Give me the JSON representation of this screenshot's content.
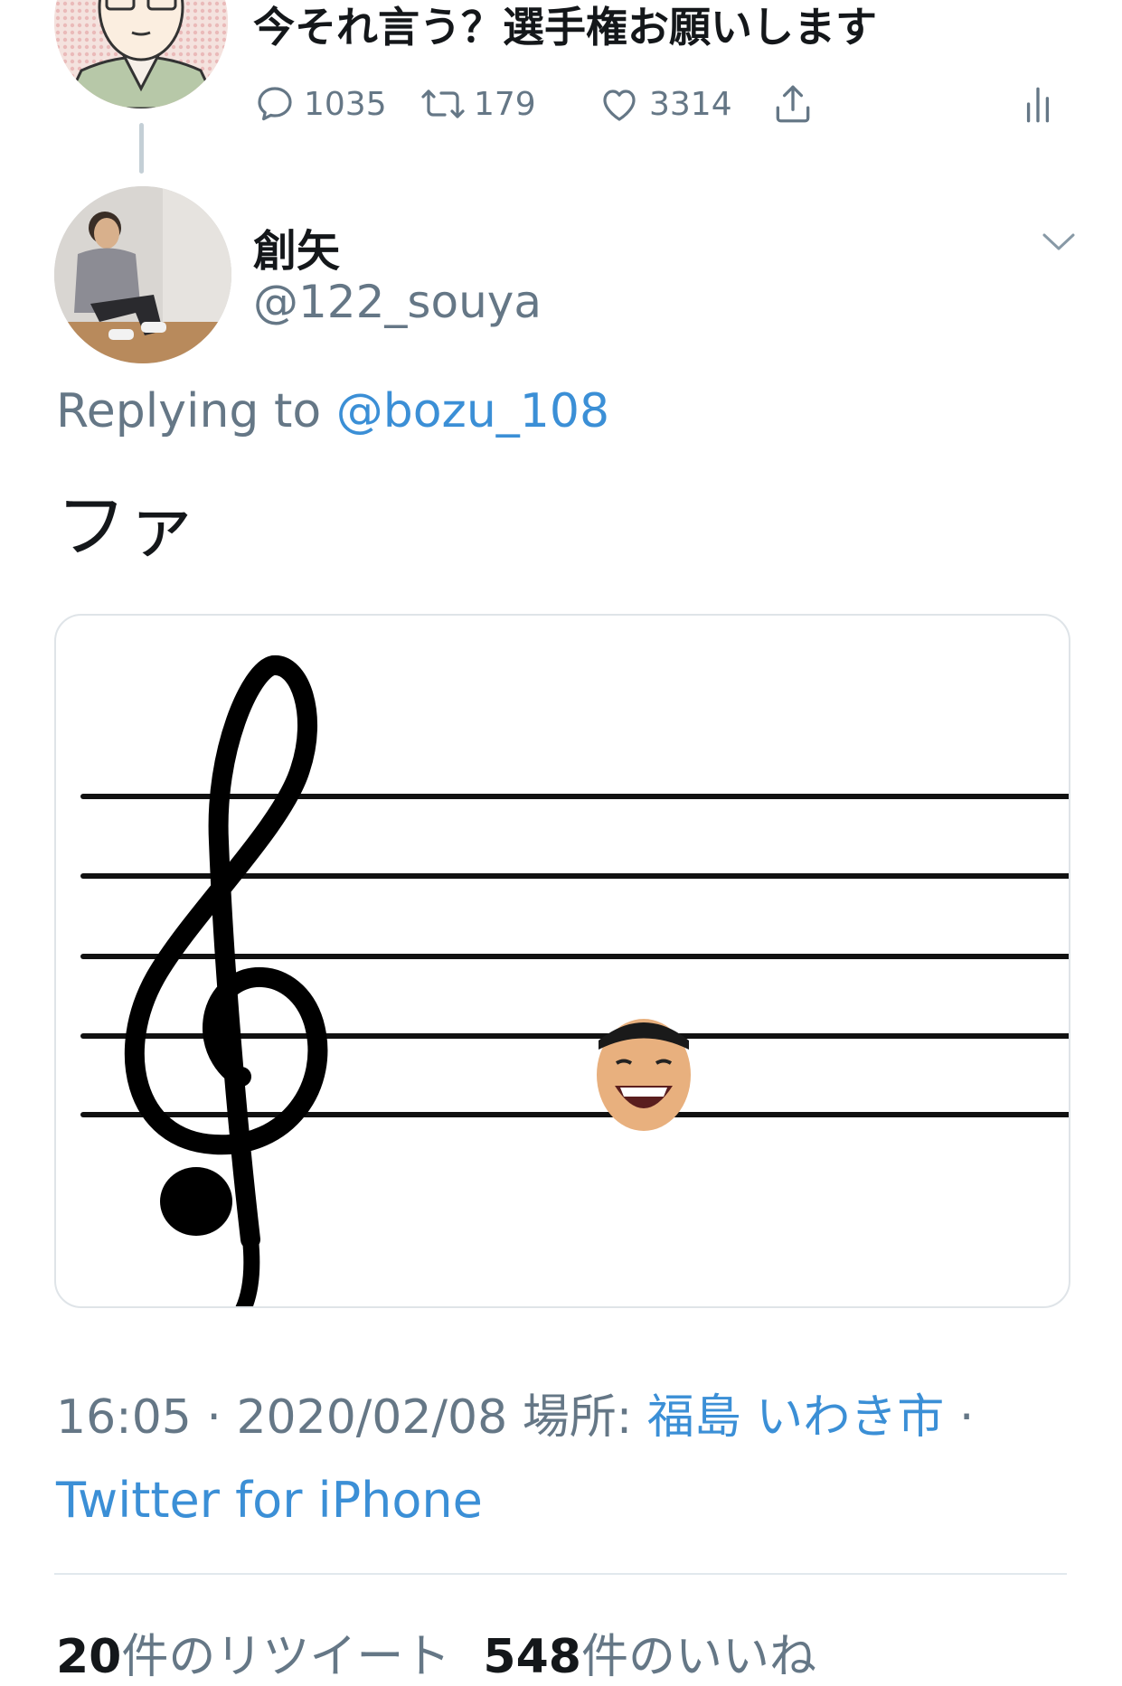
{
  "parent_tweet": {
    "text": "今それ言う？選手権お願いします",
    "actions": {
      "replies": "1035",
      "retweets": "179",
      "likes": "3314"
    },
    "icons": [
      "reply-icon",
      "retweet-icon",
      "like-icon",
      "share-icon",
      "analytics-icon"
    ]
  },
  "reply_tweet": {
    "display_name": "創矢",
    "handle": "@122_souya",
    "replying_prefix": "Replying to ",
    "replying_mention": "@bozu_108",
    "text": "ファ",
    "media_alt_icon": "treble-clef-staff-image",
    "timestamp": "16:05 · 2020/02/08",
    "location_label": "場所:",
    "location": "福島 いわき市",
    "separator": "·",
    "source": "Twitter for iPhone",
    "stats": {
      "retweets_count": "20",
      "retweets_label": "件のリツイート",
      "likes_count": "548",
      "likes_label": "件のいいね"
    }
  },
  "colors": {
    "accent": "#3b8fd6",
    "muted": "#657786",
    "text": "#14171a",
    "border": "#dfe4e8"
  }
}
